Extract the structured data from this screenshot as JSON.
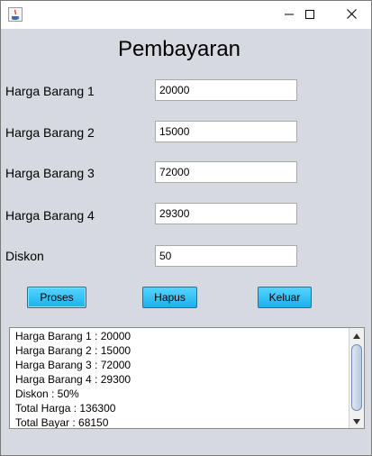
{
  "window": {
    "icon": "java-icon",
    "controls": {
      "minimize": "minimize-icon",
      "maximize": "maximize-icon",
      "close": "close-icon"
    }
  },
  "form": {
    "title": "Pembayaran",
    "fields": [
      {
        "label": "Harga Barang 1",
        "value": "20000"
      },
      {
        "label": "Harga Barang 2",
        "value": "15000"
      },
      {
        "label": "Harga Barang 3",
        "value": "72000"
      },
      {
        "label": "Harga Barang 4",
        "value": "29300"
      },
      {
        "label": "Diskon",
        "value": "50"
      }
    ]
  },
  "buttons": {
    "proses": "Proses",
    "hapus": "Hapus",
    "keluar": "Keluar",
    "color": "#1ab2ec"
  },
  "output": {
    "lines": [
      "Harga Barang 1 : 20000",
      "Harga Barang 2 : 15000",
      "Harga Barang 3 : 72000",
      "Harga Barang 4 : 29300",
      "Diskon : 50%",
      "Total Harga : 136300",
      "Total Bayar : 68150"
    ]
  }
}
